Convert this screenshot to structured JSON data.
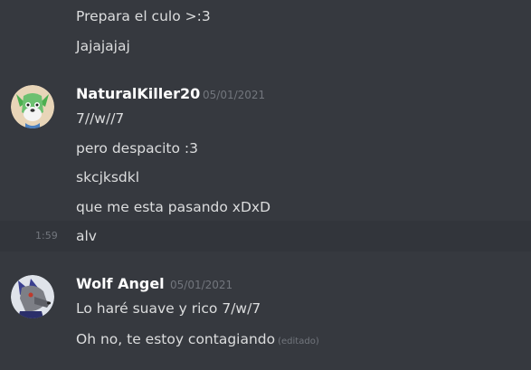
{
  "messages_top": [
    {
      "text": "Prepara el culo >:3"
    },
    {
      "text": "Jajajajaj"
    }
  ],
  "groups": [
    {
      "author": "NaturalKiller20",
      "avatar": "green-furry-character-avatar",
      "timestamp": "05/01/2021",
      "messages": [
        {
          "text": "7//w//7"
        },
        {
          "text": "pero despacito :3"
        },
        {
          "text": "skcjksdkl"
        },
        {
          "text": "que me esta pasando xDxD"
        },
        {
          "text": "alv",
          "hover_time": "1:59"
        }
      ]
    },
    {
      "author": "Wolf Angel",
      "avatar": "grey-wolf-character-avatar",
      "timestamp": "05/01/2021",
      "messages": [
        {
          "text": "Lo haré suave y rico 7/w/7"
        },
        {
          "text": "Oh no, te estoy contagiando",
          "edited": "(editado)"
        }
      ]
    }
  ],
  "colors": {
    "background": "#36393f",
    "hover_background": "#32353b",
    "text": "#dcddde",
    "username": "#ffffff",
    "muted": "#72767d"
  }
}
